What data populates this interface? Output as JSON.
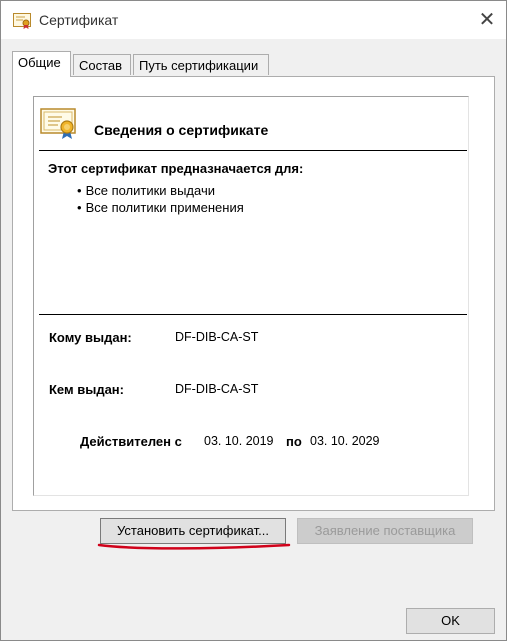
{
  "window": {
    "title": "Сертификат",
    "close_glyph": "✕"
  },
  "tabs": [
    {
      "label": "Общие",
      "active": true
    },
    {
      "label": "Состав",
      "active": false
    },
    {
      "label": "Путь сертификации",
      "active": false
    }
  ],
  "general": {
    "heading": "Сведения о сертификате",
    "purpose_title": "Этот сертификат предназначается для:",
    "purposes": [
      "Все политики выдачи",
      "Все политики применения"
    ],
    "issued_to_label": "Кому выдан:",
    "issued_to_value": "DF-DIB-CA-ST",
    "issued_by_label": "Кем выдан:",
    "issued_by_value": "DF-DIB-CA-ST",
    "valid_from_label": "Действителен с",
    "valid_from": "03. 10. 2019",
    "valid_to_label": "по",
    "valid_to": "03. 10. 2029"
  },
  "buttons": {
    "install": "Установить сертификат...",
    "issuer_statement": "Заявление поставщика",
    "ok": "OK"
  },
  "icons": {
    "window": "certificate-icon",
    "header": "certificate-ribbon-icon"
  },
  "colors": {
    "annotation": "#d0021b",
    "window_bg": "#f0f0f0",
    "panel_bg": "#ffffff"
  }
}
